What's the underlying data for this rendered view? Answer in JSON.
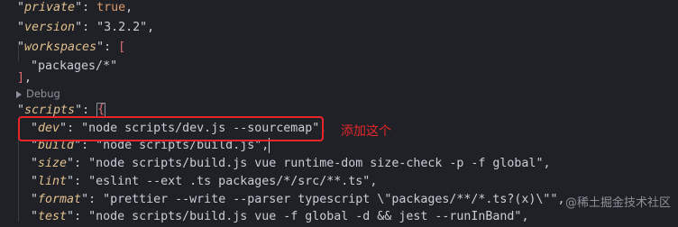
{
  "code": {
    "private": {
      "key": "private",
      "value": "true"
    },
    "version": {
      "key": "version",
      "value": "3.2.2"
    },
    "workspaces": {
      "key": "workspaces",
      "open_bracket": "[",
      "item": "packages/*",
      "close_bracket": "]"
    },
    "codelens": {
      "label": "Debug"
    },
    "scripts": {
      "key": "scripts",
      "open_brace": "{",
      "entries": [
        {
          "key": "dev",
          "value": "node scripts/dev.js --sourcemap"
        },
        {
          "key": "build",
          "value": "node scripts/build.js"
        },
        {
          "key": "size",
          "value": "node scripts/build.js vue runtime-dom size-check -p -f global"
        },
        {
          "key": "lint",
          "value": "eslint --ext .ts packages/*/src/**.ts"
        },
        {
          "key": "format",
          "value": "prettier --write --parser typescript \\\"packages/**/*.ts?(x)\\\""
        },
        {
          "key": "test",
          "value": "node scripts/build.js vue -f global -d && jest --runInBand"
        }
      ]
    }
  },
  "annotation": {
    "text": "添加这个"
  },
  "watermark": {
    "text": "@稀土掘金技术社区"
  },
  "colors": {
    "background": "#1f2127",
    "key": "#e2c08d",
    "text": "#c9ced6",
    "boolean": "#d99a6c",
    "highlight_box": "#e6262a",
    "annotation": "#e6262a"
  }
}
